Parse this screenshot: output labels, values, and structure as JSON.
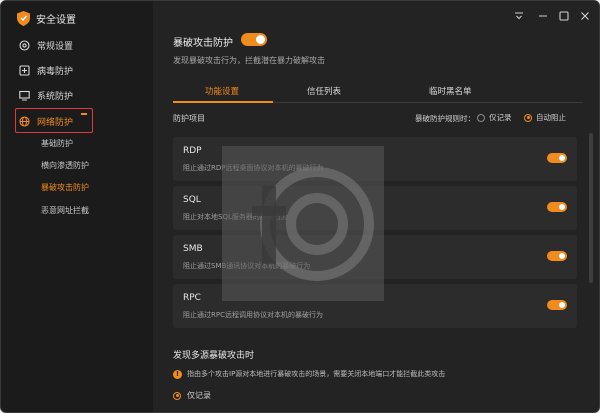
{
  "app": {
    "title": "安全设置"
  },
  "sidebar": {
    "items": [
      {
        "label": "常规设置",
        "icon": "gear-icon"
      },
      {
        "label": "病毒防护",
        "icon": "virus-shield-icon"
      },
      {
        "label": "系统防护",
        "icon": "monitor-icon"
      },
      {
        "label": "网络防护",
        "icon": "globe-icon",
        "active": true
      }
    ],
    "sub_items": [
      {
        "label": "基础防护"
      },
      {
        "label": "横向渗透防护"
      },
      {
        "label": "暴破攻击防护",
        "active": true
      },
      {
        "label": "恶意网址拦截"
      }
    ]
  },
  "header": {
    "title": "暴破攻击防护",
    "enabled": true,
    "description": "发现暴破攻击行为，拦截潜在暴力破解攻击"
  },
  "tabs": [
    {
      "label": "功能设置",
      "active": true
    },
    {
      "label": "信任列表"
    },
    {
      "label": "临时黑名单"
    }
  ],
  "protection": {
    "label": "防护项目",
    "option_label": "暴破防护规则时：",
    "options": [
      {
        "label": "仅记录",
        "checked": false
      },
      {
        "label": "自动阻止",
        "checked": true
      }
    ],
    "items": [
      {
        "name": "RDP",
        "description": "阻止通过RDP远程桌面协议对本机的暴破行为",
        "enabled": true
      },
      {
        "name": "SQL",
        "description": "阻止对本地SQL服务器的暴破行为",
        "enabled": true
      },
      {
        "name": "SMB",
        "description": "阻止通过SMB通讯协议对本机的暴破行为",
        "enabled": true
      },
      {
        "name": "RPC",
        "description": "阻止通过RPC远程调用协议对本机的暴破行为",
        "enabled": true
      }
    ]
  },
  "section2": {
    "title": "发现多源暴破攻击时",
    "info": "指由多个攻击IP源对本地进行暴破攻击的场景，需要关闭本地端口才能拦截此类攻击",
    "option": "仅记录"
  },
  "colors": {
    "accent": "#f28b1e",
    "background": "#232323",
    "sidebar": "#1b1b1b",
    "highlight_box": "#e23a3a"
  }
}
